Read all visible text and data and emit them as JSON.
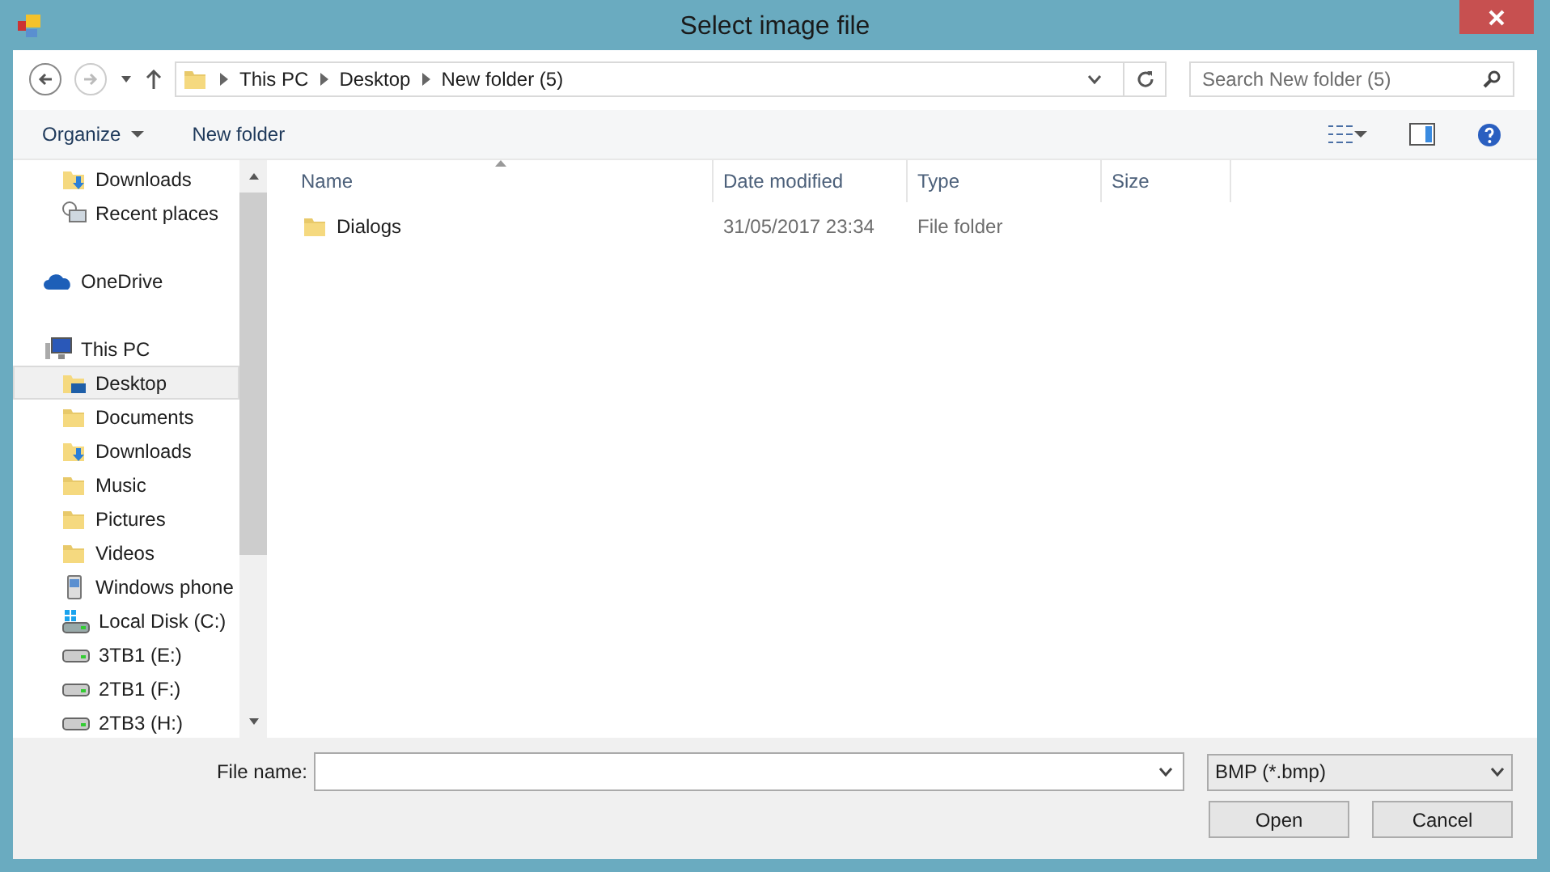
{
  "window": {
    "title": "Select image file"
  },
  "address": {
    "crumbs": [
      "This PC",
      "Desktop",
      "New folder (5)"
    ]
  },
  "search": {
    "placeholder": "Search New folder (5)"
  },
  "toolbar": {
    "organize": "Organize",
    "new_folder": "New folder"
  },
  "nav": [
    {
      "children": [
        {
          "label": "Downloads",
          "kind": "download",
          "selected": false
        },
        {
          "label": "Recent places",
          "kind": "recent",
          "selected": false
        }
      ]
    },
    {
      "label": "OneDrive",
      "kind": "cloud",
      "selected": false
    },
    {
      "label": "This PC",
      "kind": "pc",
      "selected": false,
      "children": [
        {
          "label": "Desktop",
          "kind": "desktop",
          "selected": true
        },
        {
          "label": "Documents",
          "kind": "folder",
          "selected": false
        },
        {
          "label": "Downloads",
          "kind": "download",
          "selected": false
        },
        {
          "label": "Music",
          "kind": "folder",
          "selected": false
        },
        {
          "label": "Pictures",
          "kind": "folder",
          "selected": false
        },
        {
          "label": "Videos",
          "kind": "folder",
          "selected": false
        },
        {
          "label": "Windows phone",
          "kind": "phone",
          "selected": false
        },
        {
          "label": "Local Disk (C:)",
          "kind": "system-disk",
          "selected": false
        },
        {
          "label": "3TB1 (E:)",
          "kind": "disk",
          "selected": false
        },
        {
          "label": "2TB1 (F:)",
          "kind": "disk",
          "selected": false
        },
        {
          "label": "2TB3 (H:)",
          "kind": "disk",
          "selected": false
        }
      ]
    }
  ],
  "table": {
    "columns": [
      "Name",
      "Date modified",
      "Type",
      "Size"
    ],
    "rows": [
      {
        "name": "Dialogs",
        "date": "31/05/2017 23:34",
        "type": "File folder"
      }
    ]
  },
  "file_name": {
    "label": "File name:"
  },
  "filter": {
    "value": "BMP (*.bmp)"
  },
  "buttons": [
    "Open",
    "Cancel"
  ]
}
